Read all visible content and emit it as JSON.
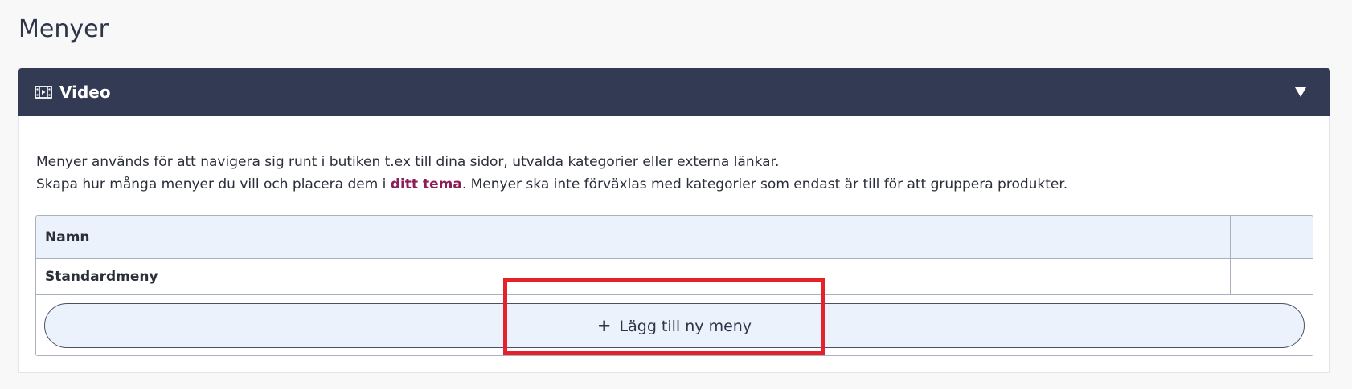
{
  "page": {
    "title": "Menyer"
  },
  "video_panel": {
    "title": "Video",
    "icon": "film-icon",
    "toggle_icon": "chevron-down-icon"
  },
  "description": {
    "line1": "Menyer används för att navigera sig runt i butiken t.ex till dina sidor, utvalda kategorier eller externa länkar.",
    "line2_before": "Skapa hur många menyer du vill och placera dem i ",
    "line2_link": "ditt tema",
    "line2_after": ". Menyer ska inte förväxlas med kategorier som endast är till för att gruppera produkter."
  },
  "table": {
    "columns": [
      "Namn",
      ""
    ],
    "rows": [
      {
        "name": "Standardmeny"
      }
    ]
  },
  "add_button": {
    "label": "Lägg till ny meny",
    "icon": "plus-icon"
  },
  "colors": {
    "header_bg": "#333a53",
    "link": "#8c1e5a",
    "table_header_bg": "#ebf2fb",
    "highlight": "#e3222b"
  }
}
